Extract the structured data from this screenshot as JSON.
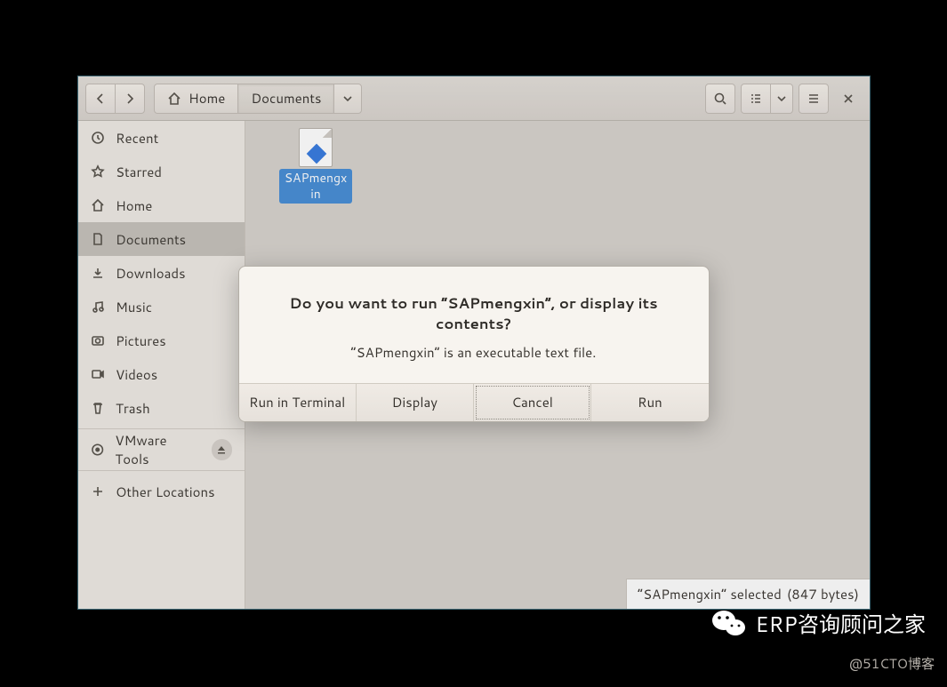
{
  "breadcrumb": {
    "home": "Home",
    "documents": "Documents"
  },
  "sidebar": {
    "recent": "Recent",
    "starred": "Starred",
    "home": "Home",
    "documents": "Documents",
    "downloads": "Downloads",
    "music": "Music",
    "pictures": "Pictures",
    "videos": "Videos",
    "trash": "Trash",
    "vmware": "VMware Tools",
    "other": "Other Locations"
  },
  "file": {
    "name": "SAPmengxin"
  },
  "statusbar": {
    "selected": "“SAPmengxin” selected",
    "size": "(847 bytes)"
  },
  "dialog": {
    "title": "Do you want to run “SAPmengxin”, or display its contents?",
    "message": "“SAPmengxin” is an executable text file.",
    "run_terminal": "Run in Terminal",
    "display": "Display",
    "cancel": "Cancel",
    "run": "Run"
  },
  "watermark": {
    "brand": "ERP咨询顾问之家",
    "sub": "@51CTO博客"
  }
}
